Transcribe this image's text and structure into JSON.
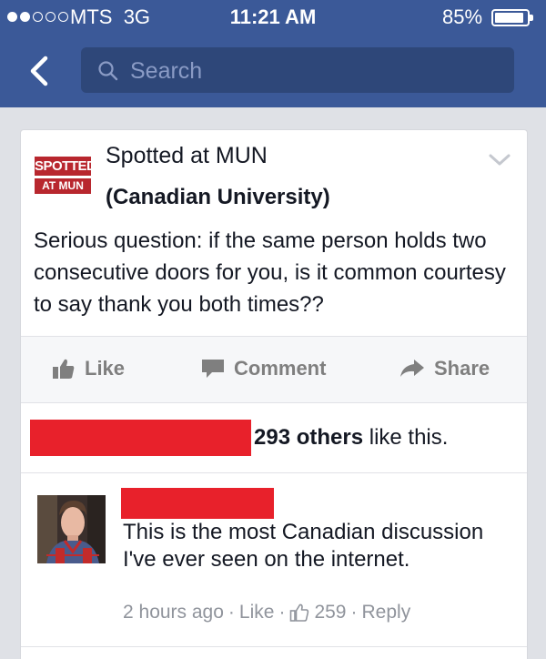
{
  "status_bar": {
    "carrier": "MTS",
    "network": "3G",
    "time": "11:21 AM",
    "battery": "85%",
    "signal_bars": 2,
    "battery_level": 0.85
  },
  "nav": {
    "search_placeholder": "Search"
  },
  "post": {
    "page_logo_top": "SPOTTED",
    "page_logo_bottom": "AT MUN",
    "page_name": "Spotted at MUN",
    "page_caption": "(Canadian University)",
    "text": "Serious question: if the same person holds two consecutive doors for you, is it common courtesy to say thank you both times??"
  },
  "actions": {
    "like": "Like",
    "comment": "Comment",
    "share": "Share"
  },
  "likes": {
    "count_text": "293 others",
    "suffix": "like this."
  },
  "comment": {
    "text": "This is the most Canadian discussion I've ever seen on the internet.",
    "time": "2 hours ago",
    "like_label": "Like",
    "like_count": "259",
    "reply_label": "Reply",
    "separator": "·"
  },
  "colors": {
    "header_blue": "#3b5998",
    "redaction": "#e8212b"
  }
}
